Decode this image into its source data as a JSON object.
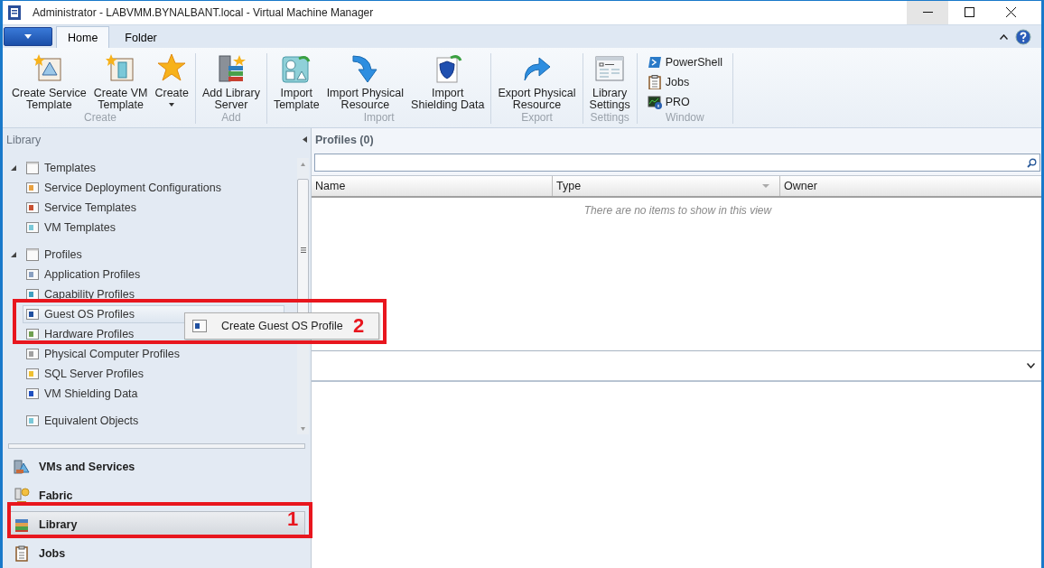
{
  "window": {
    "title": "Administrator - LABVMM.BYNALBANT.local - Virtual Machine Manager"
  },
  "ribbon": {
    "tabs": [
      {
        "label": "Home",
        "selected": true
      },
      {
        "label": "Folder",
        "selected": false
      }
    ],
    "groups": [
      {
        "label": "Create",
        "buttons": [
          {
            "label": "Create Service\nTemplate",
            "kind": "large",
            "dropdown": false
          },
          {
            "label": "Create VM\nTemplate",
            "kind": "large",
            "dropdown": false
          },
          {
            "label": "Create",
            "kind": "large",
            "dropdown": true
          }
        ]
      },
      {
        "label": "Add",
        "buttons": [
          {
            "label": "Add Library\nServer",
            "kind": "large",
            "dropdown": false
          }
        ]
      },
      {
        "label": "Import",
        "buttons": [
          {
            "label": "Import\nTemplate",
            "kind": "large",
            "dropdown": false
          },
          {
            "label": "Import Physical\nResource",
            "kind": "large",
            "dropdown": false
          },
          {
            "label": "Import\nShielding Data",
            "kind": "large",
            "dropdown": false
          }
        ]
      },
      {
        "label": "Export",
        "buttons": [
          {
            "label": "Export Physical\nResource",
            "kind": "large",
            "dropdown": false
          }
        ]
      },
      {
        "label": "Settings",
        "buttons": [
          {
            "label": "Library\nSettings",
            "kind": "large",
            "dropdown": false
          }
        ]
      },
      {
        "label": "Window",
        "buttons": [
          {
            "label": "PowerShell",
            "kind": "small",
            "dropdown": false
          },
          {
            "label": "Jobs",
            "kind": "small",
            "dropdown": false
          },
          {
            "label": "PRO",
            "kind": "small",
            "dropdown": false
          }
        ]
      }
    ]
  },
  "sidebar": {
    "title": "Library",
    "tree": [
      {
        "label": "Templates",
        "expanded": true,
        "selected": false,
        "children": [
          {
            "label": "Service Deployment Configurations",
            "selected": false
          },
          {
            "label": "Service Templates",
            "selected": false
          },
          {
            "label": "VM Templates",
            "selected": false
          }
        ]
      },
      {
        "label": "Profiles",
        "expanded": true,
        "selected": false,
        "children": [
          {
            "label": "Application Profiles",
            "selected": false
          },
          {
            "label": "Capability Profiles",
            "selected": false
          },
          {
            "label": "Guest OS Profiles",
            "selected": true
          },
          {
            "label": "Hardware Profiles",
            "selected": false
          },
          {
            "label": "Physical Computer Profiles",
            "selected": false
          },
          {
            "label": "SQL Server Profiles",
            "selected": false
          },
          {
            "label": "VM Shielding Data",
            "selected": false
          }
        ]
      },
      {
        "label": "Equivalent Objects",
        "selected": false
      }
    ],
    "nav": [
      {
        "label": "VMs and Services",
        "selected": false
      },
      {
        "label": "Fabric",
        "selected": false
      },
      {
        "label": "Library",
        "selected": true
      },
      {
        "label": "Jobs",
        "selected": false
      }
    ]
  },
  "context_menu": {
    "items": [
      {
        "label": "Create Guest OS Profile"
      }
    ]
  },
  "main": {
    "title": "Profiles (0)",
    "table": {
      "columns": [
        "Name",
        "Type",
        "Owner"
      ],
      "empty_message": "There are no items to show in this view"
    }
  },
  "annotations": [
    {
      "label": "1"
    },
    {
      "label": "2"
    }
  ]
}
